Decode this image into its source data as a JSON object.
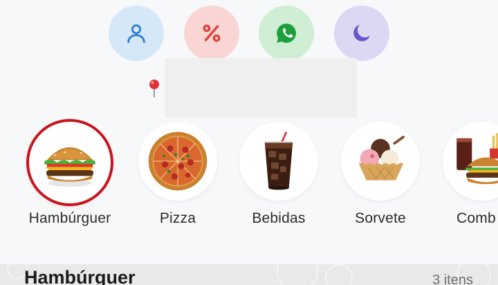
{
  "actions": {
    "profile_icon": "user-icon",
    "discount_icon": "percent-icon",
    "whatsapp_icon": "whatsapp-icon",
    "theme_icon": "moon-icon",
    "colors": {
      "profile": "#2f7fd1",
      "discount": "#e0443a",
      "whatsapp": "#1d9f3c",
      "theme": "#6a55c9"
    }
  },
  "location": {
    "pin_icon": "location-pin-icon"
  },
  "categories": [
    {
      "label": "Hambúrguer",
      "icon": "burger-image",
      "active": true
    },
    {
      "label": "Pizza",
      "icon": "pizza-image",
      "active": false
    },
    {
      "label": "Bebidas",
      "icon": "soda-image",
      "active": false
    },
    {
      "label": "Sorvete",
      "icon": "ice-cream-image",
      "active": false
    },
    {
      "label": "Comb",
      "icon": "combo-image",
      "active": false
    }
  ],
  "section": {
    "title": "Hambúrguer",
    "count": "3 itens"
  },
  "accent_color": "#c8141b"
}
